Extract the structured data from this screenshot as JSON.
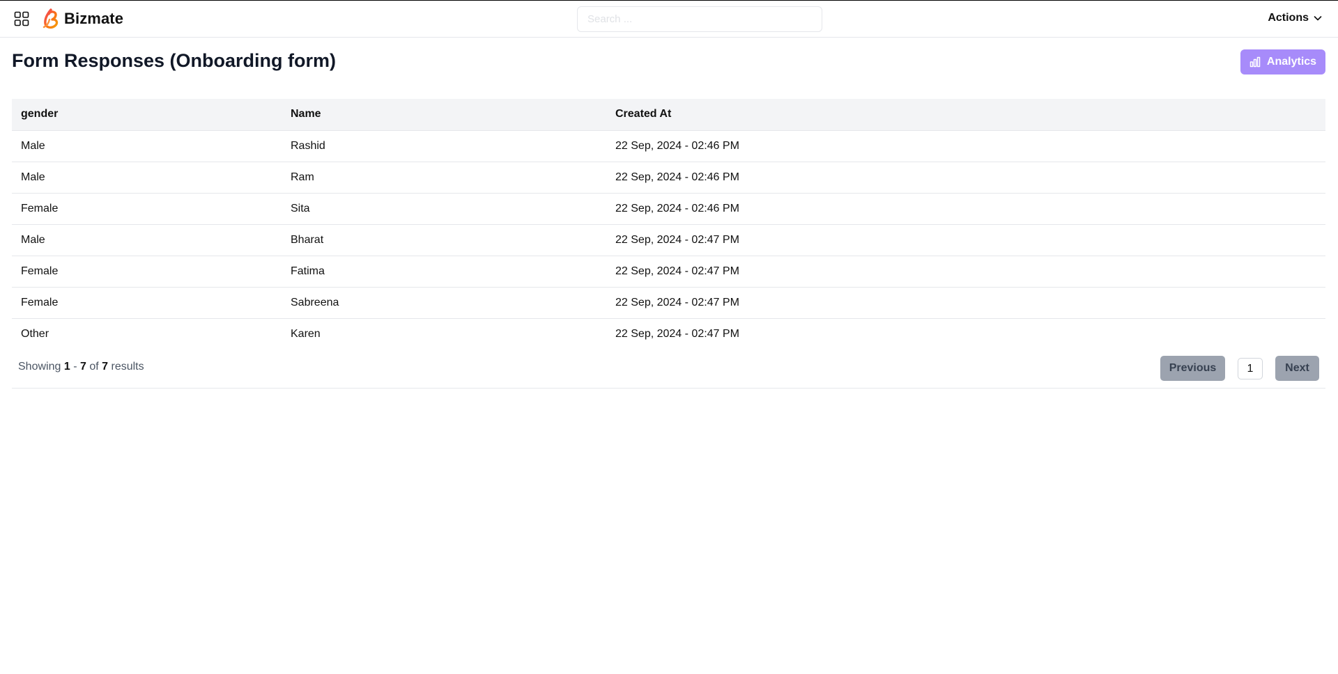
{
  "header": {
    "brand": "Bizmate",
    "search_placeholder": "Search ...",
    "actions_label": "Actions"
  },
  "page": {
    "title": "Form Responses (Onboarding form)",
    "analytics_label": "Analytics"
  },
  "table": {
    "columns": [
      "gender",
      "Name",
      "Created At"
    ],
    "rows": [
      [
        "Male",
        "Rashid",
        "22 Sep, 2024 - 02:46 PM"
      ],
      [
        "Male",
        "Ram",
        "22 Sep, 2024 - 02:46 PM"
      ],
      [
        "Female",
        "Sita",
        "22 Sep, 2024 - 02:46 PM"
      ],
      [
        "Male",
        "Bharat",
        "22 Sep, 2024 - 02:47 PM"
      ],
      [
        "Female",
        "Fatima",
        "22 Sep, 2024 - 02:47 PM"
      ],
      [
        "Female",
        "Sabreena",
        "22 Sep, 2024 - 02:47 PM"
      ],
      [
        "Other",
        "Karen",
        "22 Sep, 2024 - 02:47 PM"
      ]
    ]
  },
  "pagination": {
    "showing_prefix": "Showing",
    "from": "1",
    "sep": "-",
    "to": "7",
    "of": "of",
    "total": "7",
    "suffix": "results",
    "previous": "Previous",
    "current_page": "1",
    "next": "Next"
  },
  "colors": {
    "accent": "#a78bfa",
    "disabled_button": "#9ca3af",
    "header_row": "#f3f4f6"
  },
  "icons": {
    "apps": "grid-icon",
    "brand": "bizmate-logo-icon",
    "actions_caret": "chevron-down-icon",
    "analytics": "bar-chart-icon"
  }
}
